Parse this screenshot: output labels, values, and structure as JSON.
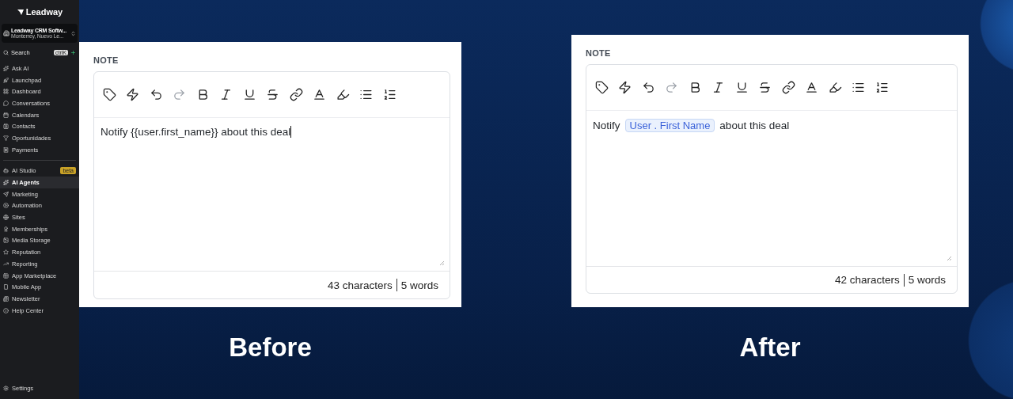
{
  "sidebar": {
    "logo": "Leadway",
    "account": {
      "name": "Leadway CRM Softw...",
      "location": "Monterrey, Nuevo Le..."
    },
    "search": {
      "label": "Search",
      "shortcut": "ctrlK"
    },
    "groups": [
      [
        {
          "label": "Ask AI",
          "selected": false
        },
        {
          "label": "Launchpad",
          "selected": false
        },
        {
          "label": "Dashboard",
          "selected": false
        },
        {
          "label": "Conversations",
          "selected": false
        },
        {
          "label": "Calendars",
          "selected": false
        },
        {
          "label": "Contacts",
          "selected": false
        },
        {
          "label": "Oportunidades",
          "selected": false
        },
        {
          "label": "Payments",
          "selected": false
        }
      ],
      [
        {
          "label": "AI Studio",
          "selected": false,
          "badge": "beta"
        },
        {
          "label": "AI Agents",
          "selected": true
        },
        {
          "label": "Marketing",
          "selected": false
        },
        {
          "label": "Automation",
          "selected": false
        },
        {
          "label": "Sites",
          "selected": false
        },
        {
          "label": "Memberships",
          "selected": false
        },
        {
          "label": "Media Storage",
          "selected": false
        },
        {
          "label": "Reputation",
          "selected": false
        },
        {
          "label": "Reporting",
          "selected": false
        },
        {
          "label": "App Marketplace",
          "selected": false
        },
        {
          "label": "Mobile App",
          "selected": false
        },
        {
          "label": "Newsletter",
          "selected": false
        },
        {
          "label": "Help Center",
          "selected": false
        }
      ]
    ],
    "settings": "Settings"
  },
  "panels": [
    {
      "label": "NOTE",
      "caption": "Before",
      "toolbar": [
        {
          "kind": "tag",
          "disabled": false
        },
        {
          "kind": "zap",
          "disabled": false
        },
        {
          "kind": "undo",
          "disabled": false
        },
        {
          "kind": "redo",
          "disabled": true
        },
        {
          "kind": "bold",
          "disabled": false
        },
        {
          "kind": "italic",
          "disabled": false
        },
        {
          "kind": "underline",
          "disabled": false
        },
        {
          "kind": "strike",
          "disabled": false
        },
        {
          "kind": "link",
          "disabled": false
        },
        {
          "kind": "color",
          "disabled": false
        },
        {
          "kind": "highlight",
          "disabled": false
        },
        {
          "kind": "bullets",
          "disabled": false
        },
        {
          "kind": "numbers",
          "disabled": false
        }
      ],
      "content": [
        {
          "kind": "text",
          "text": "Notify {{user.first_name}} about this deal"
        }
      ],
      "caret": true,
      "characters": "43 characters",
      "words": "5 words"
    },
    {
      "label": "NOTE",
      "caption": "After",
      "toolbar": [
        {
          "kind": "tag",
          "disabled": false
        },
        {
          "kind": "zap",
          "disabled": false
        },
        {
          "kind": "undo",
          "disabled": false
        },
        {
          "kind": "redo",
          "disabled": true
        },
        {
          "kind": "bold",
          "disabled": false
        },
        {
          "kind": "italic",
          "disabled": false
        },
        {
          "kind": "underline",
          "disabled": false
        },
        {
          "kind": "strike",
          "disabled": false
        },
        {
          "kind": "link",
          "disabled": false
        },
        {
          "kind": "color",
          "disabled": false
        },
        {
          "kind": "highlight",
          "disabled": false
        },
        {
          "kind": "bullets",
          "disabled": false
        },
        {
          "kind": "numbers",
          "disabled": false
        }
      ],
      "content": [
        {
          "kind": "text",
          "text": "Notify"
        },
        {
          "kind": "chip",
          "text": "User . First Name"
        },
        {
          "kind": "text",
          "text": "about this deal"
        }
      ],
      "caret": false,
      "characters": "42 characters",
      "words": "5 words"
    }
  ]
}
